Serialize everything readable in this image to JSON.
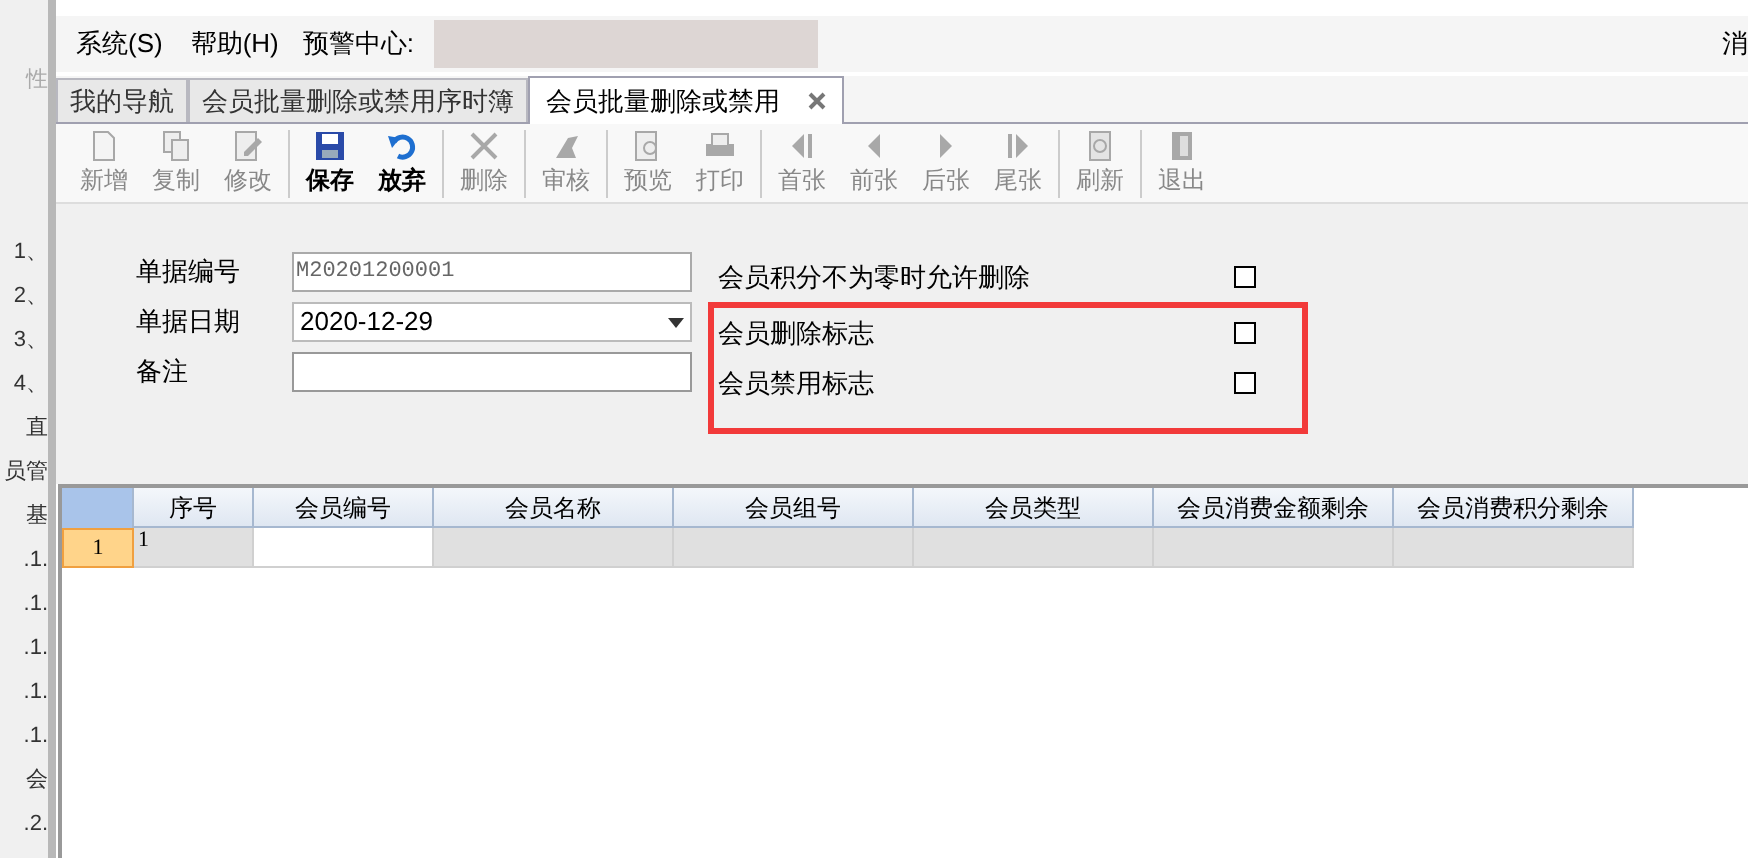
{
  "side_fragments_top": "性",
  "side_fragments": [
    "1、",
    "2、",
    "3、",
    "4、",
    "直",
    "员管",
    "基",
    ".1.",
    ".1.",
    ".1.",
    ".1.",
    ".1.",
    "会",
    ".2."
  ],
  "menu": [
    {
      "label": "系统(S)"
    },
    {
      "label": "帮助(H)"
    }
  ],
  "alert_label": "预警中心:",
  "menu_right": "消",
  "tabs": [
    {
      "label": "我的导航",
      "selected": false,
      "closable": false
    },
    {
      "label": "会员批量删除或禁用序时簿",
      "selected": false,
      "closable": false
    },
    {
      "label": "会员批量删除或禁用",
      "selected": true,
      "closable": true
    }
  ],
  "toolbar": [
    [
      {
        "label": "新增",
        "kind": "new",
        "disabled": true
      },
      {
        "label": "复制",
        "kind": "copy",
        "disabled": true
      },
      {
        "label": "修改",
        "kind": "edit",
        "disabled": true
      }
    ],
    [
      {
        "label": "保存",
        "kind": "save",
        "disabled": false
      },
      {
        "label": "放弃",
        "kind": "undo",
        "disabled": false
      }
    ],
    [
      {
        "label": "删除",
        "kind": "delete",
        "disabled": true
      }
    ],
    [
      {
        "label": "审核",
        "kind": "stamp",
        "disabled": true
      }
    ],
    [
      {
        "label": "预览",
        "kind": "preview",
        "disabled": true
      },
      {
        "label": "打印",
        "kind": "print",
        "disabled": true
      }
    ],
    [
      {
        "label": "首张",
        "kind": "first",
        "disabled": true
      },
      {
        "label": "前张",
        "kind": "prev",
        "disabled": true
      },
      {
        "label": "后张",
        "kind": "next",
        "disabled": true
      },
      {
        "label": "尾张",
        "kind": "last",
        "disabled": true
      }
    ],
    [
      {
        "label": "刷新",
        "kind": "refresh",
        "disabled": true
      }
    ],
    [
      {
        "label": "退出",
        "kind": "exit",
        "disabled": true
      }
    ]
  ],
  "form_fields": [
    {
      "label": "单据编号",
      "kind": "readonly",
      "value": "M20201200001"
    },
    {
      "label": "单据日期",
      "kind": "date",
      "value": "2020-12-29"
    },
    {
      "label": "备注",
      "kind": "text"
    }
  ],
  "flags": [
    {
      "label": "会员积分不为零时允许删除",
      "checked": false,
      "highlighted": false
    },
    {
      "label": "会员删除标志",
      "checked": false,
      "highlighted": true
    },
    {
      "label": "会员禁用标志",
      "checked": false,
      "highlighted": true
    }
  ],
  "table": {
    "columns": [
      "序号",
      "会员编号",
      "会员名称",
      "会员组号",
      "会员类型",
      "会员消费金额剩余",
      "会员消费积分剩余"
    ],
    "rows": [
      {
        "header": "1",
        "selected": true,
        "cells": [
          "1",
          "",
          "",
          "",
          "",
          "",
          ""
        ]
      }
    ]
  }
}
